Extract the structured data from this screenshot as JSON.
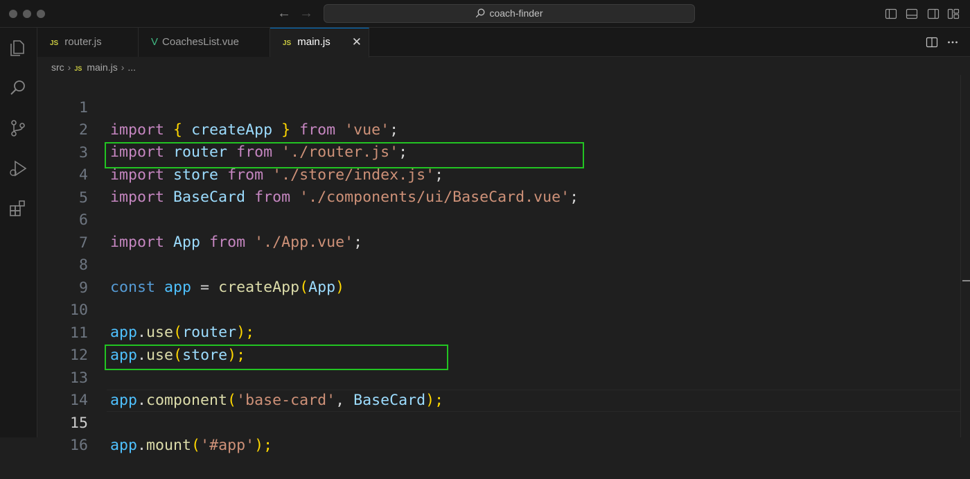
{
  "window": {
    "title": "coach-finder"
  },
  "tabs": [
    {
      "label": "router.js",
      "badge": "JS"
    },
    {
      "label": "CoachesList.vue",
      "badge": "V"
    },
    {
      "label": "main.js",
      "badge": "JS",
      "close": "✕"
    }
  ],
  "breadcrumb": {
    "folder": "src",
    "badge": "JS",
    "file": "main.js",
    "more": "..."
  },
  "editor": {
    "line_numbers": [
      "1",
      "2",
      "3",
      "4",
      "5",
      "6",
      "7",
      "8",
      "9",
      "10",
      "11",
      "12",
      "13",
      "14",
      "15",
      "16"
    ],
    "current_line": "15",
    "highlighted_lines": [
      "4",
      "13"
    ],
    "code": {
      "l1": [
        "import",
        " ",
        "{",
        " ",
        "createApp",
        " ",
        "}",
        " ",
        "from",
        " ",
        "'vue'",
        ";"
      ],
      "l2": [
        "import",
        " ",
        "router",
        " ",
        "from",
        " ",
        "'./router.js'",
        ";"
      ],
      "l3": [
        "import",
        " ",
        "store",
        " ",
        "from",
        " ",
        "'./store/index.js'",
        ";"
      ],
      "l4": [
        "import",
        " ",
        "BaseCard",
        " ",
        "from",
        " ",
        "'./components/ui/BaseCard.vue'",
        ";"
      ],
      "l6": [
        "import",
        " ",
        "App",
        " ",
        "from",
        " ",
        "'./App.vue'",
        ";"
      ],
      "l8": [
        "const",
        " ",
        "app",
        " = ",
        "createApp",
        "(",
        "App",
        ")"
      ],
      "l10": [
        "app",
        ".",
        "use",
        "(",
        "router",
        ");"
      ],
      "l11": [
        "app",
        ".",
        "use",
        "(",
        "store",
        ");"
      ],
      "l13": [
        "app",
        ".",
        "component",
        "(",
        "'base-card'",
        ", ",
        "BaseCard",
        ");"
      ],
      "l15": [
        "app",
        ".",
        "mount",
        "(",
        "'#app'",
        ");"
      ]
    }
  },
  "icons": {
    "activity": [
      "explorer-icon",
      "search-icon",
      "source-control-icon",
      "run-debug-icon",
      "extensions-icon"
    ],
    "titlebar": [
      "back-arrow-icon",
      "forward-arrow-icon",
      "search-icon",
      "toggle-sidebar-icon",
      "toggle-panel-icon",
      "toggle-secondary-sidebar-icon",
      "customize-layout-icon"
    ],
    "tabbar": [
      "split-editor-icon",
      "more-actions-icon"
    ]
  },
  "colors": {
    "background": "#1f1f1f",
    "keyword": "#c586c0",
    "string": "#ce9178",
    "variable": "#9cdcfe",
    "function": "#dcdcaa",
    "highlight_box": "#22c422"
  }
}
